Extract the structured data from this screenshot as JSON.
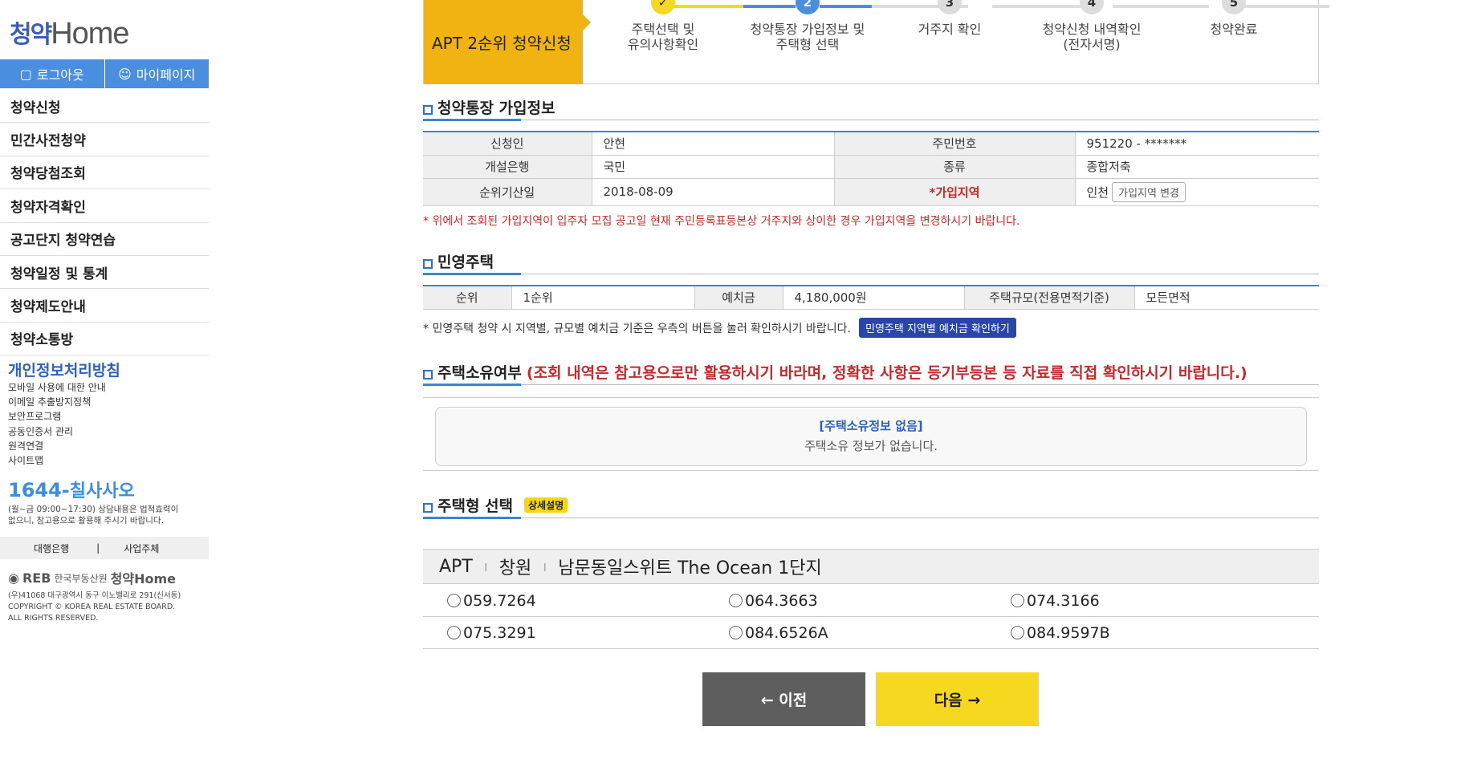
{
  "sidebar": {
    "logo_korean": "청약",
    "logo_english": "Home",
    "logout_label": "로그아웃",
    "mypage_label": "마이페이지",
    "menu": [
      "청약신청",
      "민간사전청약",
      "청약당첨조회",
      "청약자격확인",
      "공고단지 청약연습",
      "청약일정 및 통계",
      "청약제도안내",
      "청약소통방"
    ],
    "privacy_title": "개인정보처리방침",
    "privacy_links": [
      "모바일 사용에 대한 안내",
      "이메일 추출방지정책",
      "보안프로그램",
      "공동인증서 관리",
      "원격연결",
      "사이트맵"
    ],
    "phone_prefix": "1644-",
    "phone_word": "칠사사오",
    "phone_note1": "(월~금 09:00~17:30) 상담내용은 법적효력이",
    "phone_note2": "없으니, 참고용으로 활용해 주시기 바랍니다.",
    "bank_link": "대행은행",
    "operator_link": "사업주체",
    "divider": "|",
    "footer_logo": "REB",
    "footer_org": "한국부동산원",
    "footer_brand": "청약Home",
    "footer_address": "(우)41068 대구광역시 동구 이노밸리로 291(신서동)",
    "footer_copy1": "COPYRIGHT © KOREA REAL ESTATE BOARD.",
    "footer_copy2": "ALL RIGHTS RESERVED."
  },
  "header": {
    "title": "APT 2순위 청약신청",
    "steps": [
      {
        "num": "✓",
        "line1": "주택선택 및",
        "line2": "유의사항확인"
      },
      {
        "num": "2",
        "line1": "청약통장 가입정보 및",
        "line2": "주택형 선택"
      },
      {
        "num": "3",
        "line1": "거주지 확인",
        "line2": ""
      },
      {
        "num": "4",
        "line1": "청약신청 내역확인",
        "line2": "(전자서명)"
      },
      {
        "num": "5",
        "line1": "청약완료",
        "line2": ""
      }
    ]
  },
  "account": {
    "title": "청약통장 가입정보",
    "applicant_label": "신청인",
    "applicant": "안현",
    "id_label": "주민번호",
    "id": "951220 - *******",
    "bank_label": "개설은행",
    "bank": "국민",
    "type_label": "종류",
    "type": "종합저축",
    "date_label": "순위기산일",
    "date": "2018-08-09",
    "region_label": "*가입지역",
    "region": "인천",
    "region_btn": "가입지역 변경",
    "note": "* 위에서 조회된 가입지역이 입주자 모집 공고일 현재 주민등록표등본상 거주지와 상이한 경우 가입지역을 변경하시기 바랍니다."
  },
  "private_housing": {
    "title": "민영주택",
    "rank_label": "순위",
    "rank": "1순위",
    "deposit_label": "예치금",
    "deposit": "4,180,000원",
    "size_label": "주택규모(전용면적기준)",
    "size": "모든면적",
    "note": "* 민영주택 청약 시 지역별, 규모별 예치금 기준은 우측의 버튼을 눌러 확인하시기 바랍니다.",
    "btn": "민영주택 지역별 예치금 확인하기"
  },
  "ownership": {
    "title": "주택소유여부",
    "warning": "(조회 내역은 참고용으로만 활용하시기 바라며, 정확한 사항은 등기부등본 등 자료를 직접 확인하시기 바랍니다.)",
    "box_title": "[주택소유정보 없음]",
    "box_text": "주택소유 정보가 없습니다."
  },
  "housing_type": {
    "title": "주택형 선택",
    "badge": "상세설명",
    "cat1": "APT",
    "cat2": "창원",
    "complex": "남문동일스위트 The Ocean 1단지",
    "options": [
      "059.7264",
      "064.3663",
      "074.3166",
      "075.3291",
      "084.6526A",
      "084.9597B"
    ]
  },
  "buttons": {
    "prev": "← 이전",
    "next": "다음 →"
  },
  "colors": {
    "accent_blue": "#3a85d4",
    "apt_yellow": "#f0b311",
    "next_yellow": "#f5d81f",
    "warn_red": "#c8282b"
  }
}
